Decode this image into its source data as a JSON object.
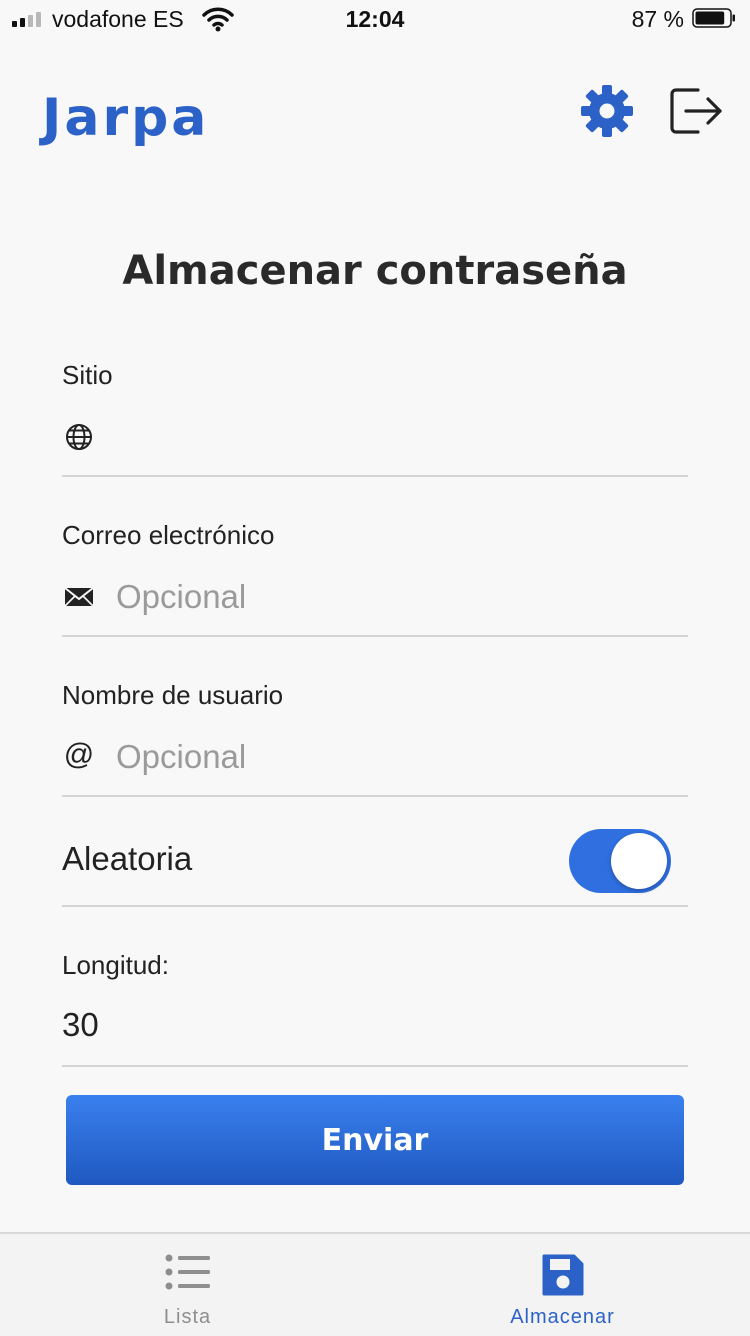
{
  "status_bar": {
    "carrier": "vodafone ES",
    "time": "12:04",
    "battery_percent": "87 %",
    "battery_level": 0.87
  },
  "header": {
    "brand": "Jarpa",
    "settings_icon": "gear-icon",
    "logout_icon": "logout-icon",
    "accent_color": "#2c62c7"
  },
  "page": {
    "title": "Almacenar contraseña"
  },
  "form": {
    "site": {
      "label": "Sitio",
      "value": "",
      "placeholder": "",
      "icon": "globe-icon"
    },
    "email": {
      "label": "Correo electrónico",
      "value": "",
      "placeholder": "Opcional",
      "icon": "envelope-icon"
    },
    "username": {
      "label": "Nombre de usuario",
      "value": "",
      "placeholder": "Opcional",
      "icon": "at-icon",
      "icon_glyph": "@"
    },
    "random": {
      "label": "Aleatoria",
      "enabled": true,
      "toggle_color": "#2f6fe0"
    },
    "length": {
      "label": "Longitud:",
      "value": "30"
    },
    "submit_label": "Enviar"
  },
  "tab_bar": {
    "tabs": [
      {
        "label": "Lista",
        "icon": "list-icon",
        "active": false,
        "color": "#8e8e8e"
      },
      {
        "label": "Almacenar",
        "icon": "save-icon",
        "active": true,
        "color": "#2c62c7"
      }
    ]
  }
}
